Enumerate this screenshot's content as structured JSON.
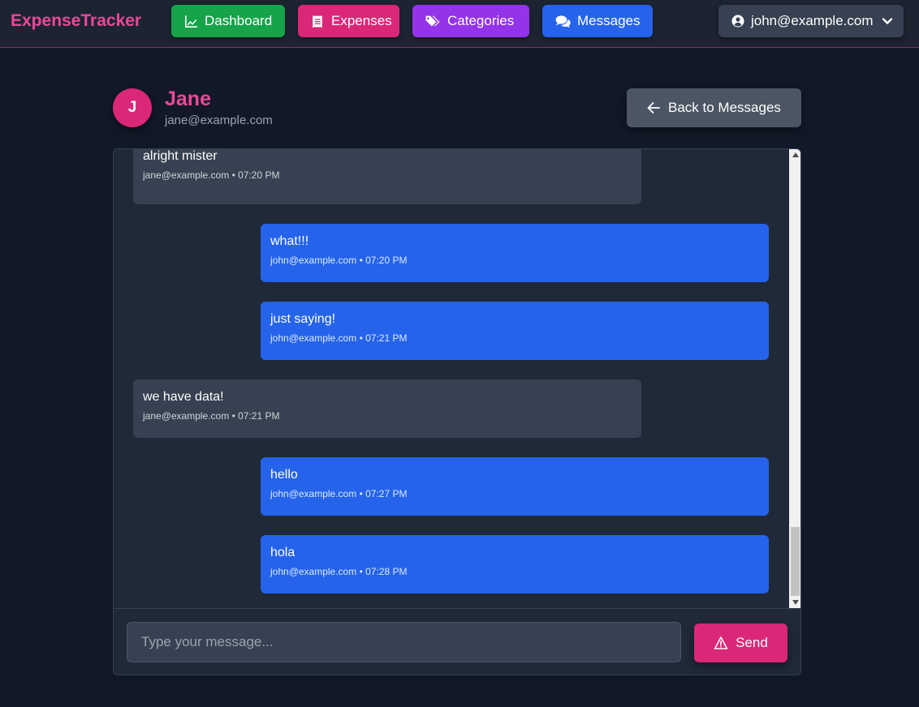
{
  "app": {
    "brand": "ExpenseTracker"
  },
  "nav": {
    "dashboard": "Dashboard",
    "expenses": "Expenses",
    "categories": "Categories",
    "messages": "Messages"
  },
  "user_menu": {
    "email": "john@example.com"
  },
  "contact": {
    "initial": "J",
    "name": "Jane",
    "email": "jane@example.com"
  },
  "back_button": {
    "label": "Back to Messages"
  },
  "messages": [
    {
      "direction": "received",
      "text": "alright mister",
      "sender": "jane@example.com",
      "time": "07:20 PM",
      "meta": "jane@example.com • 07:20 PM"
    },
    {
      "direction": "sent",
      "text": "what!!!",
      "sender": "john@example.com",
      "time": "07:20 PM",
      "meta": "john@example.com • 07:20 PM"
    },
    {
      "direction": "sent",
      "text": "just saying!",
      "sender": "john@example.com",
      "time": "07:21 PM",
      "meta": "john@example.com • 07:21 PM"
    },
    {
      "direction": "received",
      "text": "we have data!",
      "sender": "jane@example.com",
      "time": "07:21 PM",
      "meta": "jane@example.com • 07:21 PM"
    },
    {
      "direction": "sent",
      "text": "hello",
      "sender": "john@example.com",
      "time": "07:27 PM",
      "meta": "john@example.com • 07:27 PM"
    },
    {
      "direction": "sent",
      "text": "hola",
      "sender": "john@example.com",
      "time": "07:28 PM",
      "meta": "john@example.com • 07:28 PM"
    }
  ],
  "composer": {
    "placeholder": "Type your message...",
    "value": "",
    "send_label": "Send"
  },
  "icons": {
    "dashboard": "chart-line-icon",
    "expenses": "receipt-icon",
    "categories": "tags-icon",
    "messages": "comments-icon",
    "user": "user-circle-icon",
    "dropdown": "chevron-down-icon",
    "back": "arrow-left-icon",
    "send": "warning-triangle-icon"
  },
  "colors": {
    "background": "#111827",
    "navbar": "#1c2431",
    "brand": "#ec4899",
    "dashboard": "#16a34a",
    "expenses": "#db2777",
    "categories": "#9333ea",
    "messages": "#2563eb",
    "sent_bubble": "#2563eb",
    "received_bubble": "#374151",
    "send_button": "#db2777"
  }
}
